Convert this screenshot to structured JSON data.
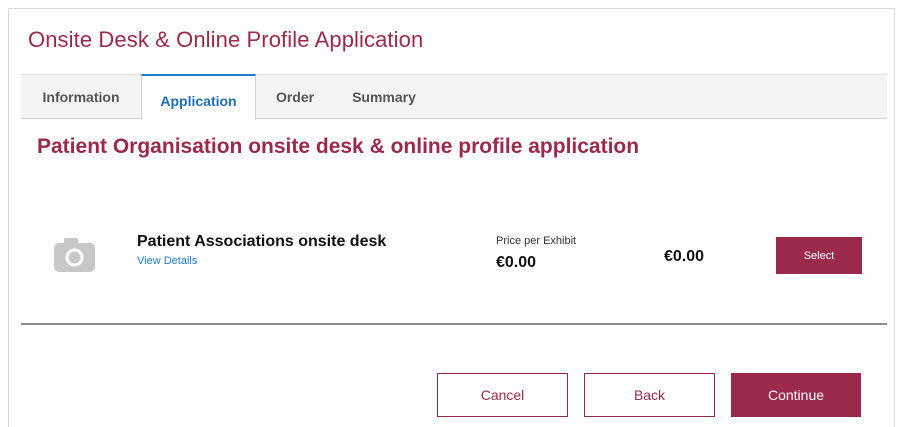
{
  "window": {
    "title": "Onsite Desk & Online Profile Application"
  },
  "tabs": [
    {
      "label": "Information",
      "active": false
    },
    {
      "label": "Application",
      "active": true
    },
    {
      "label": "Order",
      "active": false
    },
    {
      "label": "Summary",
      "active": false
    }
  ],
  "section": {
    "title": "Patient Organisation onsite desk & online profile application"
  },
  "product": {
    "icon": "camera-icon",
    "name": "Patient Associations onsite desk",
    "details_link": "View Details",
    "price_label": "Price per Exhibit",
    "price": "€0.00",
    "total": "€0.00",
    "select_label": "Select"
  },
  "actions": {
    "cancel_label": "Cancel",
    "back_label": "Back",
    "continue_label": "Continue"
  },
  "colors": {
    "brand": "#9b2a4a",
    "link": "#1f7bd1",
    "active_tab_text": "#1f6fb5",
    "icon_gray": "#c8c8c8"
  }
}
